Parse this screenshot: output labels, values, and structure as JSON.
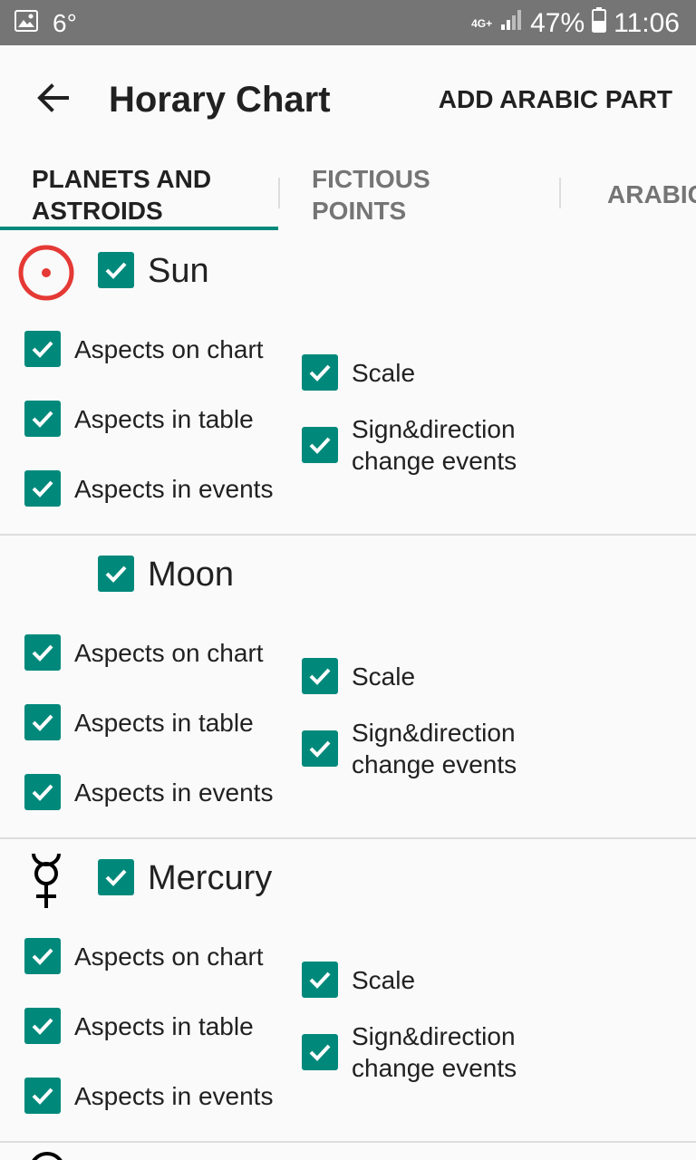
{
  "status_bar": {
    "temperature": "6°",
    "network": "4G+",
    "battery": "47%",
    "time": "11:06"
  },
  "app_bar": {
    "title": "Horary Chart",
    "action_label": "ADD ARABIC PART"
  },
  "tabs": [
    {
      "label_line1": "PLANETS AND",
      "label_line2": "ASTROIDS",
      "active": true
    },
    {
      "label_line1": "FICTIOUS",
      "label_line2": "POINTS",
      "active": false
    },
    {
      "label_line1": "ARABIC",
      "label_line2": "",
      "active": false
    }
  ],
  "planets": [
    {
      "name": "Sun",
      "symbol": "sun-symbol",
      "color": "#e53935",
      "options": {
        "aspects_on_chart": "Aspects on chart",
        "aspects_in_table": "Aspects in table",
        "aspects_in_events": "Aspects in events",
        "scale": "Scale",
        "sign_direction_line1": "Sign&direction",
        "sign_direction_line2": "change events"
      }
    },
    {
      "name": "Moon",
      "symbol": "moon-symbol",
      "color": "#e53935",
      "options": {
        "aspects_on_chart": "Aspects on chart",
        "aspects_in_table": "Aspects in table",
        "aspects_in_events": "Aspects in events",
        "scale": "Scale",
        "sign_direction_line1": "Sign&direction",
        "sign_direction_line2": "change events"
      }
    },
    {
      "name": "Mercury",
      "symbol": "mercury-symbol",
      "color": "#000000",
      "options": {
        "aspects_on_chart": "Aspects on chart",
        "aspects_in_table": "Aspects in table",
        "aspects_in_events": "Aspects in events",
        "scale": "Scale",
        "sign_direction_line1": "Sign&direction",
        "sign_direction_line2": "change events"
      }
    }
  ],
  "colors": {
    "accent": "#00897b",
    "status_bar": "#757575"
  }
}
